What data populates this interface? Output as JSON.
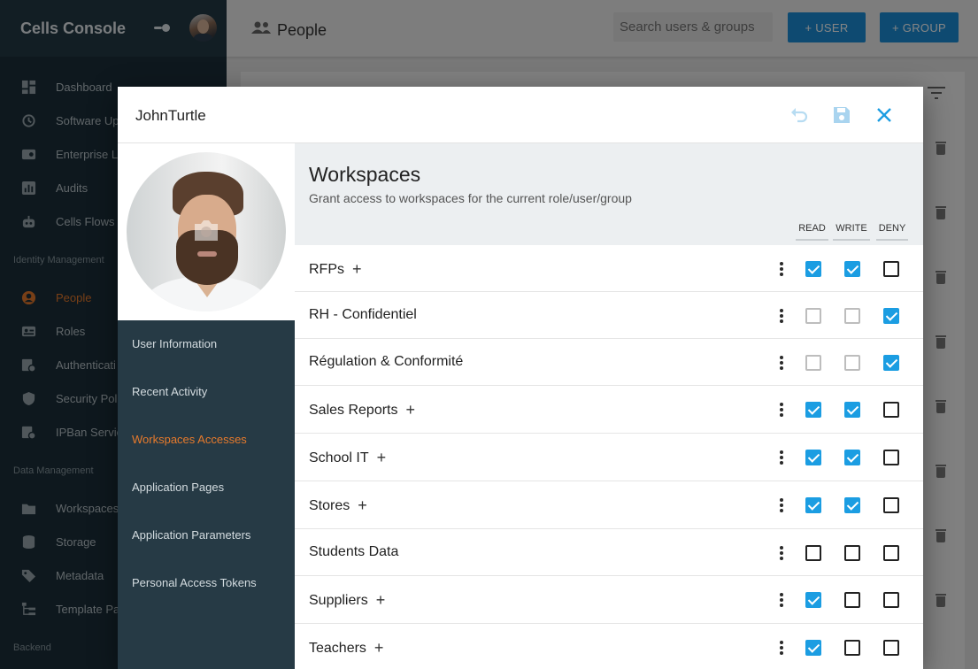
{
  "app": {
    "title": "Cells Console",
    "sections": [
      "Identity Management",
      "Data Management",
      "Backend"
    ],
    "nav": [
      {
        "label": "Dashboard",
        "icon": "dashboard-icon"
      },
      {
        "label": "Software Up",
        "icon": "update-icon"
      },
      {
        "label": "Enterprise L",
        "icon": "license-icon"
      },
      {
        "label": "Audits",
        "icon": "audit-icon"
      },
      {
        "label": "Cells Flows",
        "icon": "robot-icon"
      },
      {
        "label": "People",
        "icon": "person-icon",
        "active": true
      },
      {
        "label": "Roles",
        "icon": "roles-icon"
      },
      {
        "label": "Authenticati",
        "icon": "auth-icon"
      },
      {
        "label": "Security Pol",
        "icon": "shield-icon"
      },
      {
        "label": "IPBan Servic",
        "icon": "ipban-icon"
      },
      {
        "label": "Workspaces",
        "icon": "folder-icon"
      },
      {
        "label": "Storage",
        "icon": "database-icon"
      },
      {
        "label": "Metadata",
        "icon": "tag-icon"
      },
      {
        "label": "Template Pa",
        "icon": "tree-icon"
      }
    ]
  },
  "topbar": {
    "title": "People",
    "search_placeholder": "Search users & groups",
    "add_user": "+ USER",
    "add_group": "+ GROUP"
  },
  "modal": {
    "title": "JohnTurtle",
    "menu": [
      {
        "label": "User Information"
      },
      {
        "label": "Recent Activity"
      },
      {
        "label": "Workspaces Accesses",
        "active": true
      },
      {
        "label": "Application Pages"
      },
      {
        "label": "Application Parameters"
      },
      {
        "label": "Personal Access Tokens"
      }
    ],
    "workspaces": {
      "title": "Workspaces",
      "subtitle": "Grant access to workspaces for the current role/user/group",
      "columns": [
        "READ",
        "WRITE",
        "DENY"
      ],
      "rows": [
        {
          "name": "RFPs",
          "plus": true,
          "read": "on",
          "write": "on",
          "deny": "off"
        },
        {
          "name": "RH - Confidentiel",
          "plus": false,
          "read": "dis",
          "write": "dis",
          "deny": "on"
        },
        {
          "name": "Régulation & Conformité",
          "plus": false,
          "read": "dis",
          "write": "dis",
          "deny": "on"
        },
        {
          "name": "Sales Reports",
          "plus": true,
          "read": "on",
          "write": "on",
          "deny": "off"
        },
        {
          "name": "School IT",
          "plus": true,
          "read": "on",
          "write": "on",
          "deny": "off"
        },
        {
          "name": "Stores",
          "plus": true,
          "read": "on",
          "write": "on",
          "deny": "off"
        },
        {
          "name": "Students Data",
          "plus": false,
          "read": "off",
          "write": "off",
          "deny": "off"
        },
        {
          "name": "Suppliers",
          "plus": true,
          "read": "on",
          "write": "off",
          "deny": "off"
        },
        {
          "name": "Teachers",
          "plus": true,
          "read": "on",
          "write": "off",
          "deny": "off"
        }
      ]
    }
  },
  "colors": {
    "sidebar_bg": "#1b2f3a",
    "accent_orange": "#e77a2c",
    "accent_blue": "#1b8fd8",
    "checkbox_blue": "#1b9de2"
  }
}
